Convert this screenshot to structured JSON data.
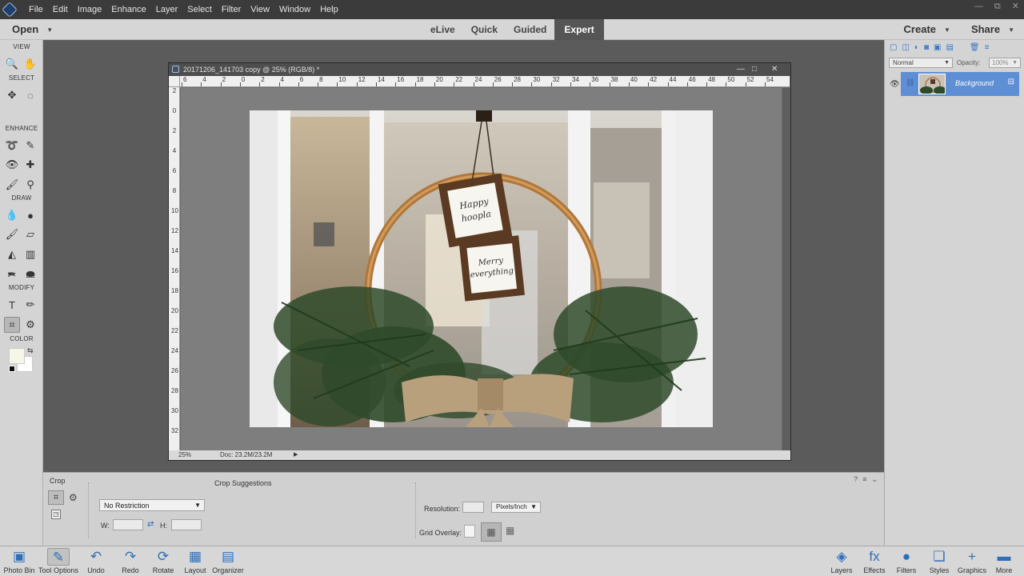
{
  "menubar": {
    "items": [
      "File",
      "Edit",
      "Image",
      "Enhance",
      "Layer",
      "Select",
      "Filter",
      "View",
      "Window",
      "Help"
    ],
    "window_controls": [
      "—",
      "⧉",
      "✕"
    ]
  },
  "modebar": {
    "open_label": "Open",
    "modes": [
      "eLive",
      "Quick",
      "Guided",
      "Expert"
    ],
    "active_mode": "Expert",
    "create_label": "Create",
    "share_label": "Share"
  },
  "toolbox": {
    "sections": [
      "VIEW",
      "SELECT",
      "ENHANCE",
      "DRAW",
      "MODIFY",
      "COLOR"
    ],
    "tools": [
      {
        "name": "zoom-icon",
        "glyph": "🔍"
      },
      {
        "name": "hand-icon",
        "glyph": "✋"
      },
      {
        "name": "move-icon",
        "glyph": "✥"
      },
      {
        "name": "elliptical-marquee-icon",
        "glyph": "◌"
      },
      {
        "name": "lasso-icon",
        "glyph": "➰"
      },
      {
        "name": "quick-selection-icon",
        "glyph": "✎"
      },
      {
        "name": "red-eye-icon",
        "glyph": "👁"
      },
      {
        "name": "spot-healing-icon",
        "glyph": "✚"
      },
      {
        "name": "smart-brush-icon",
        "glyph": "🖌"
      },
      {
        "name": "clone-stamp-icon",
        "glyph": "⚲"
      },
      {
        "name": "blur-icon",
        "glyph": "💧"
      },
      {
        "name": "sponge-icon",
        "glyph": "●"
      },
      {
        "name": "brush-icon",
        "glyph": "🖌"
      },
      {
        "name": "eraser-icon",
        "glyph": "▱"
      },
      {
        "name": "paint-bucket-icon",
        "glyph": "◭"
      },
      {
        "name": "gradient-icon",
        "glyph": "▥"
      },
      {
        "name": "eyedropper-icon",
        "glyph": "✒"
      },
      {
        "name": "custom-shape-icon",
        "glyph": "⬬"
      },
      {
        "name": "type-icon",
        "glyph": "T"
      },
      {
        "name": "pencil-icon",
        "glyph": "✏"
      },
      {
        "name": "crop-icon",
        "glyph": "⌗"
      },
      {
        "name": "recompose-icon",
        "glyph": "⚙"
      },
      {
        "name": "content-aware-move-icon",
        "glyph": "✂"
      },
      {
        "name": "straighten-icon",
        "glyph": "▭"
      }
    ],
    "foreground_color": "#f6f7e6",
    "background_color": "#ffffff"
  },
  "document": {
    "title": "20171206_141703 copy @ 25% (RGB/8) *",
    "window_buttons": [
      "—",
      "□",
      "✕"
    ],
    "ruler_top_labels": [
      "6",
      "4",
      "2",
      "0",
      "2",
      "4",
      "6",
      "8",
      "10",
      "12",
      "14",
      "16",
      "18",
      "20",
      "22",
      "24",
      "26",
      "28",
      "30",
      "32",
      "34",
      "36",
      "38",
      "40",
      "42",
      "44",
      "46",
      "48",
      "50",
      "52",
      "54"
    ],
    "ruler_left_labels": [
      "2",
      "0",
      "2",
      "4",
      "6",
      "8",
      "10",
      "12",
      "14",
      "16",
      "18",
      "20",
      "22",
      "24",
      "26",
      "28",
      "30",
      "32"
    ],
    "zoom": "25%",
    "doc_size": "Doc: 23.2M/23.2M",
    "photo_sign_1_line1": "Happy",
    "photo_sign_1_line2": "hoopla",
    "photo_sign_2_line1": "Merry",
    "photo_sign_2_line2": "everything"
  },
  "tool_options": {
    "tool_name": "Crop",
    "crop_suggestions_label": "Crop Suggestions",
    "restriction": "No Restriction",
    "w_label": "W:",
    "h_label": "H:",
    "w_value": "",
    "h_value": "",
    "resolution_label": "Resolution:",
    "resolution_value": "",
    "resolution_unit": "Pixels/Inch",
    "grid_overlay_label": "Grid Overlay:"
  },
  "layers_panel": {
    "blend_mode": "Normal",
    "opacity_label": "Opacity:",
    "opacity_value": "100%",
    "layer_name": "Background"
  },
  "bottombar": {
    "left": [
      {
        "label": "Photo Bin",
        "glyph": "▣",
        "name": "photo-bin"
      },
      {
        "label": "Tool Options",
        "glyph": "✎",
        "name": "tool-options"
      },
      {
        "label": "Undo",
        "glyph": "↶",
        "name": "undo"
      },
      {
        "label": "Redo",
        "glyph": "↷",
        "name": "redo"
      },
      {
        "label": "Rotate",
        "glyph": "⟳",
        "name": "rotate"
      },
      {
        "label": "Layout",
        "glyph": "▦",
        "name": "layout"
      },
      {
        "label": "Organizer",
        "glyph": "▤",
        "name": "organizer"
      }
    ],
    "right": [
      {
        "label": "Layers",
        "glyph": "◈",
        "name": "layers"
      },
      {
        "label": "Effects",
        "glyph": "fx",
        "name": "effects"
      },
      {
        "label": "Filters",
        "glyph": "●",
        "name": "filters"
      },
      {
        "label": "Styles",
        "glyph": "❏",
        "name": "styles"
      },
      {
        "label": "Graphics",
        "glyph": "+",
        "name": "graphics"
      },
      {
        "label": "More",
        "glyph": "▬",
        "name": "more"
      }
    ]
  }
}
